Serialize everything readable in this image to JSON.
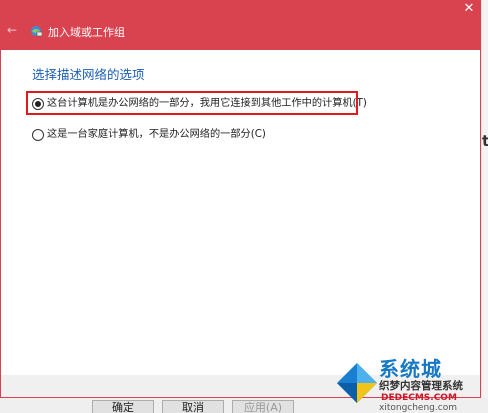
{
  "dialog": {
    "title": "加入域或工作组",
    "back_icon": "back-arrow-icon",
    "close_glyph": "✕",
    "heading": "选择描述网络的选项",
    "options": [
      {
        "label": "这台计算机是办公网络的一部分，我用它连接到其他工作中的计算机(T)",
        "selected": true
      },
      {
        "label": "这是一台家庭计算机，不是办公网络的一部分(C)",
        "selected": false
      }
    ],
    "colors": {
      "titlebar": "#d9424f",
      "heading": "#1c5fb6",
      "highlight": "#e0191d"
    }
  },
  "background": {
    "right_fragment": "te",
    "bottom_buttons": [
      "确定",
      "取消",
      "应用(A)"
    ]
  },
  "watermark": {
    "title": "系统城",
    "subtitle": "织梦内容管理系统",
    "url": "DEDECMS.COM",
    "domain": "xitongcheng.com"
  }
}
